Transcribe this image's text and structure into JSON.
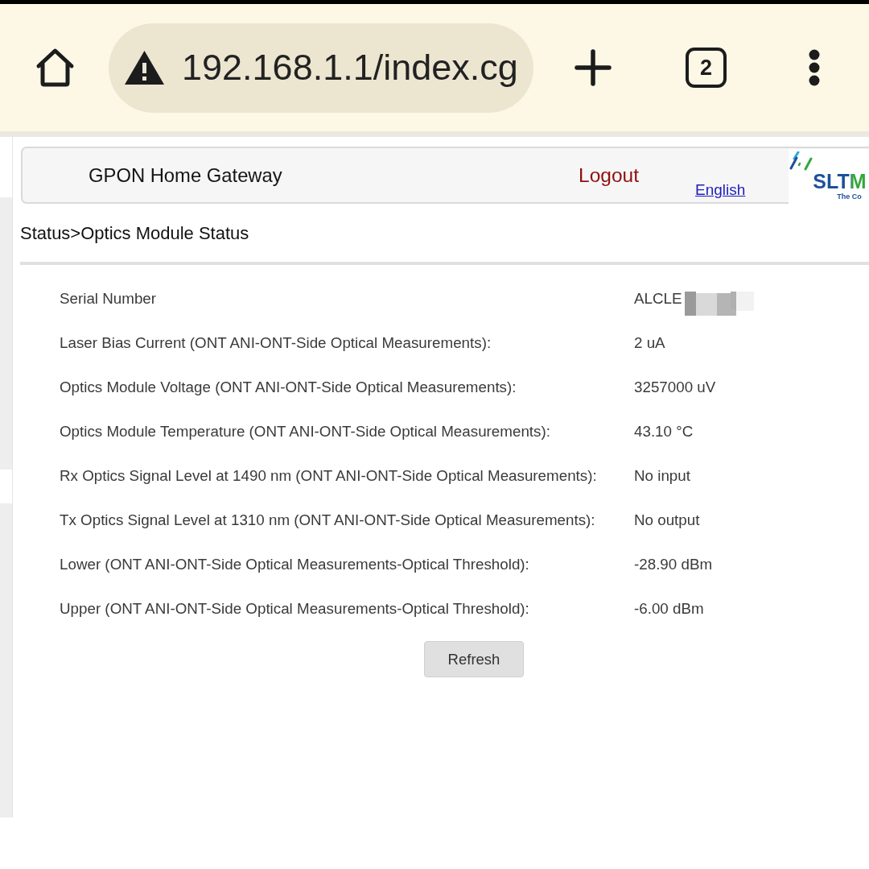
{
  "browser": {
    "url": "192.168.1.1/index.cg",
    "tab_count": "2"
  },
  "header": {
    "title": "GPON Home Gateway",
    "logout": "Logout",
    "language": "English",
    "logo": {
      "wordmark": "SLTM",
      "tagline": "The Co"
    }
  },
  "breadcrumb": "Status>Optics Module Status",
  "rows": [
    {
      "label": "Serial Number",
      "value": "ALCLE",
      "redacted": true
    },
    {
      "label": "Laser Bias Current (ONT ANI-ONT-Side Optical Measurements):",
      "value": "2 uA",
      "redacted": false
    },
    {
      "label": "Optics Module Voltage (ONT ANI-ONT-Side Optical Measurements):",
      "value": "3257000 uV",
      "redacted": false
    },
    {
      "label": "Optics Module Temperature (ONT ANI-ONT-Side Optical Measurements):",
      "value": "43.10 °C",
      "redacted": false
    },
    {
      "label": "Rx Optics Signal Level at 1490 nm (ONT ANI-ONT-Side Optical Measurements):",
      "value": "No input",
      "redacted": false
    },
    {
      "label": "Tx Optics Signal Level at 1310 nm (ONT ANI-ONT-Side Optical Measurements):",
      "value": "No output",
      "redacted": false
    },
    {
      "label": "Lower (ONT ANI-ONT-Side Optical Measurements-Optical Threshold):",
      "value": "-28.90 dBm",
      "redacted": false
    },
    {
      "label": "Upper (ONT ANI-ONT-Side Optical Measurements-Optical Threshold):",
      "value": "-6.00 dBm",
      "redacted": false
    }
  ],
  "buttons": [
    {
      "label": "Refresh"
    }
  ]
}
